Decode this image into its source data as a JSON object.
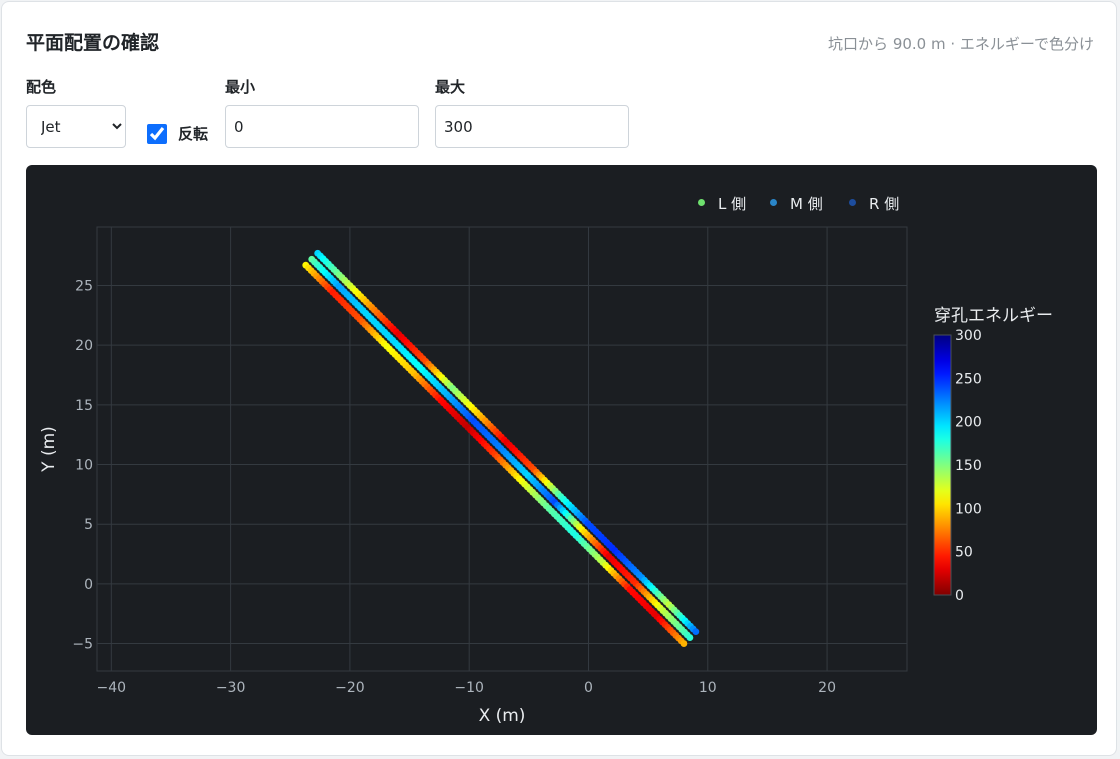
{
  "header": {
    "title": "平面配置の確認",
    "subtitle": "坑口から 90.0 m · エネルギーで色分け"
  },
  "controls": {
    "colormap_label": "配色",
    "colormap_value": "Jet",
    "reverse_label": "反転",
    "reverse_checked": true,
    "min_label": "最小",
    "min_value": "0",
    "max_label": "最大",
    "max_value": "300"
  },
  "chart_data": {
    "type": "scatter",
    "xlabel": "X (m)",
    "ylabel": "Y (m)",
    "xlim": [
      -41.2,
      26.7
    ],
    "ylim": [
      -7.3,
      29.9
    ],
    "xticks": [
      -40,
      -30,
      -20,
      -10,
      0,
      10,
      20
    ],
    "yticks": [
      -5,
      0,
      5,
      10,
      15,
      20,
      25
    ],
    "grid": true,
    "legend_position": "top-right",
    "colorbar": {
      "title": "穿孔エネルギー",
      "min": 0,
      "max": 300,
      "ticks": [
        0,
        50,
        100,
        150,
        200,
        250,
        300
      ],
      "colormap": "Jet",
      "reversed": true
    },
    "series": [
      {
        "name": "L 側",
        "legend_color": "#6ee06e",
        "start": [
          -23.7,
          26.7
        ],
        "end": [
          8.0,
          -5.0
        ],
        "energy_profile": [
          110,
          45,
          60,
          115,
          95,
          40,
          20,
          55,
          115,
          160,
          180,
          130,
          40,
          30,
          90
        ]
      },
      {
        "name": "M 側",
        "legend_color": "#2a86c9",
        "start": [
          -23.2,
          27.2
        ],
        "end": [
          8.5,
          -4.5
        ],
        "energy_profile": [
          160,
          215,
          200,
          200,
          185,
          210,
          240,
          225,
          200,
          240,
          110,
          30,
          50,
          130,
          175
        ]
      },
      {
        "name": "R 側",
        "legend_color": "#1d4d9e",
        "start": [
          -22.7,
          27.7
        ],
        "end": [
          9.0,
          -4.0
        ],
        "energy_profile": [
          200,
          140,
          80,
          30,
          60,
          150,
          95,
          30,
          60,
          170,
          240,
          250,
          220,
          130,
          230
        ]
      }
    ]
  }
}
